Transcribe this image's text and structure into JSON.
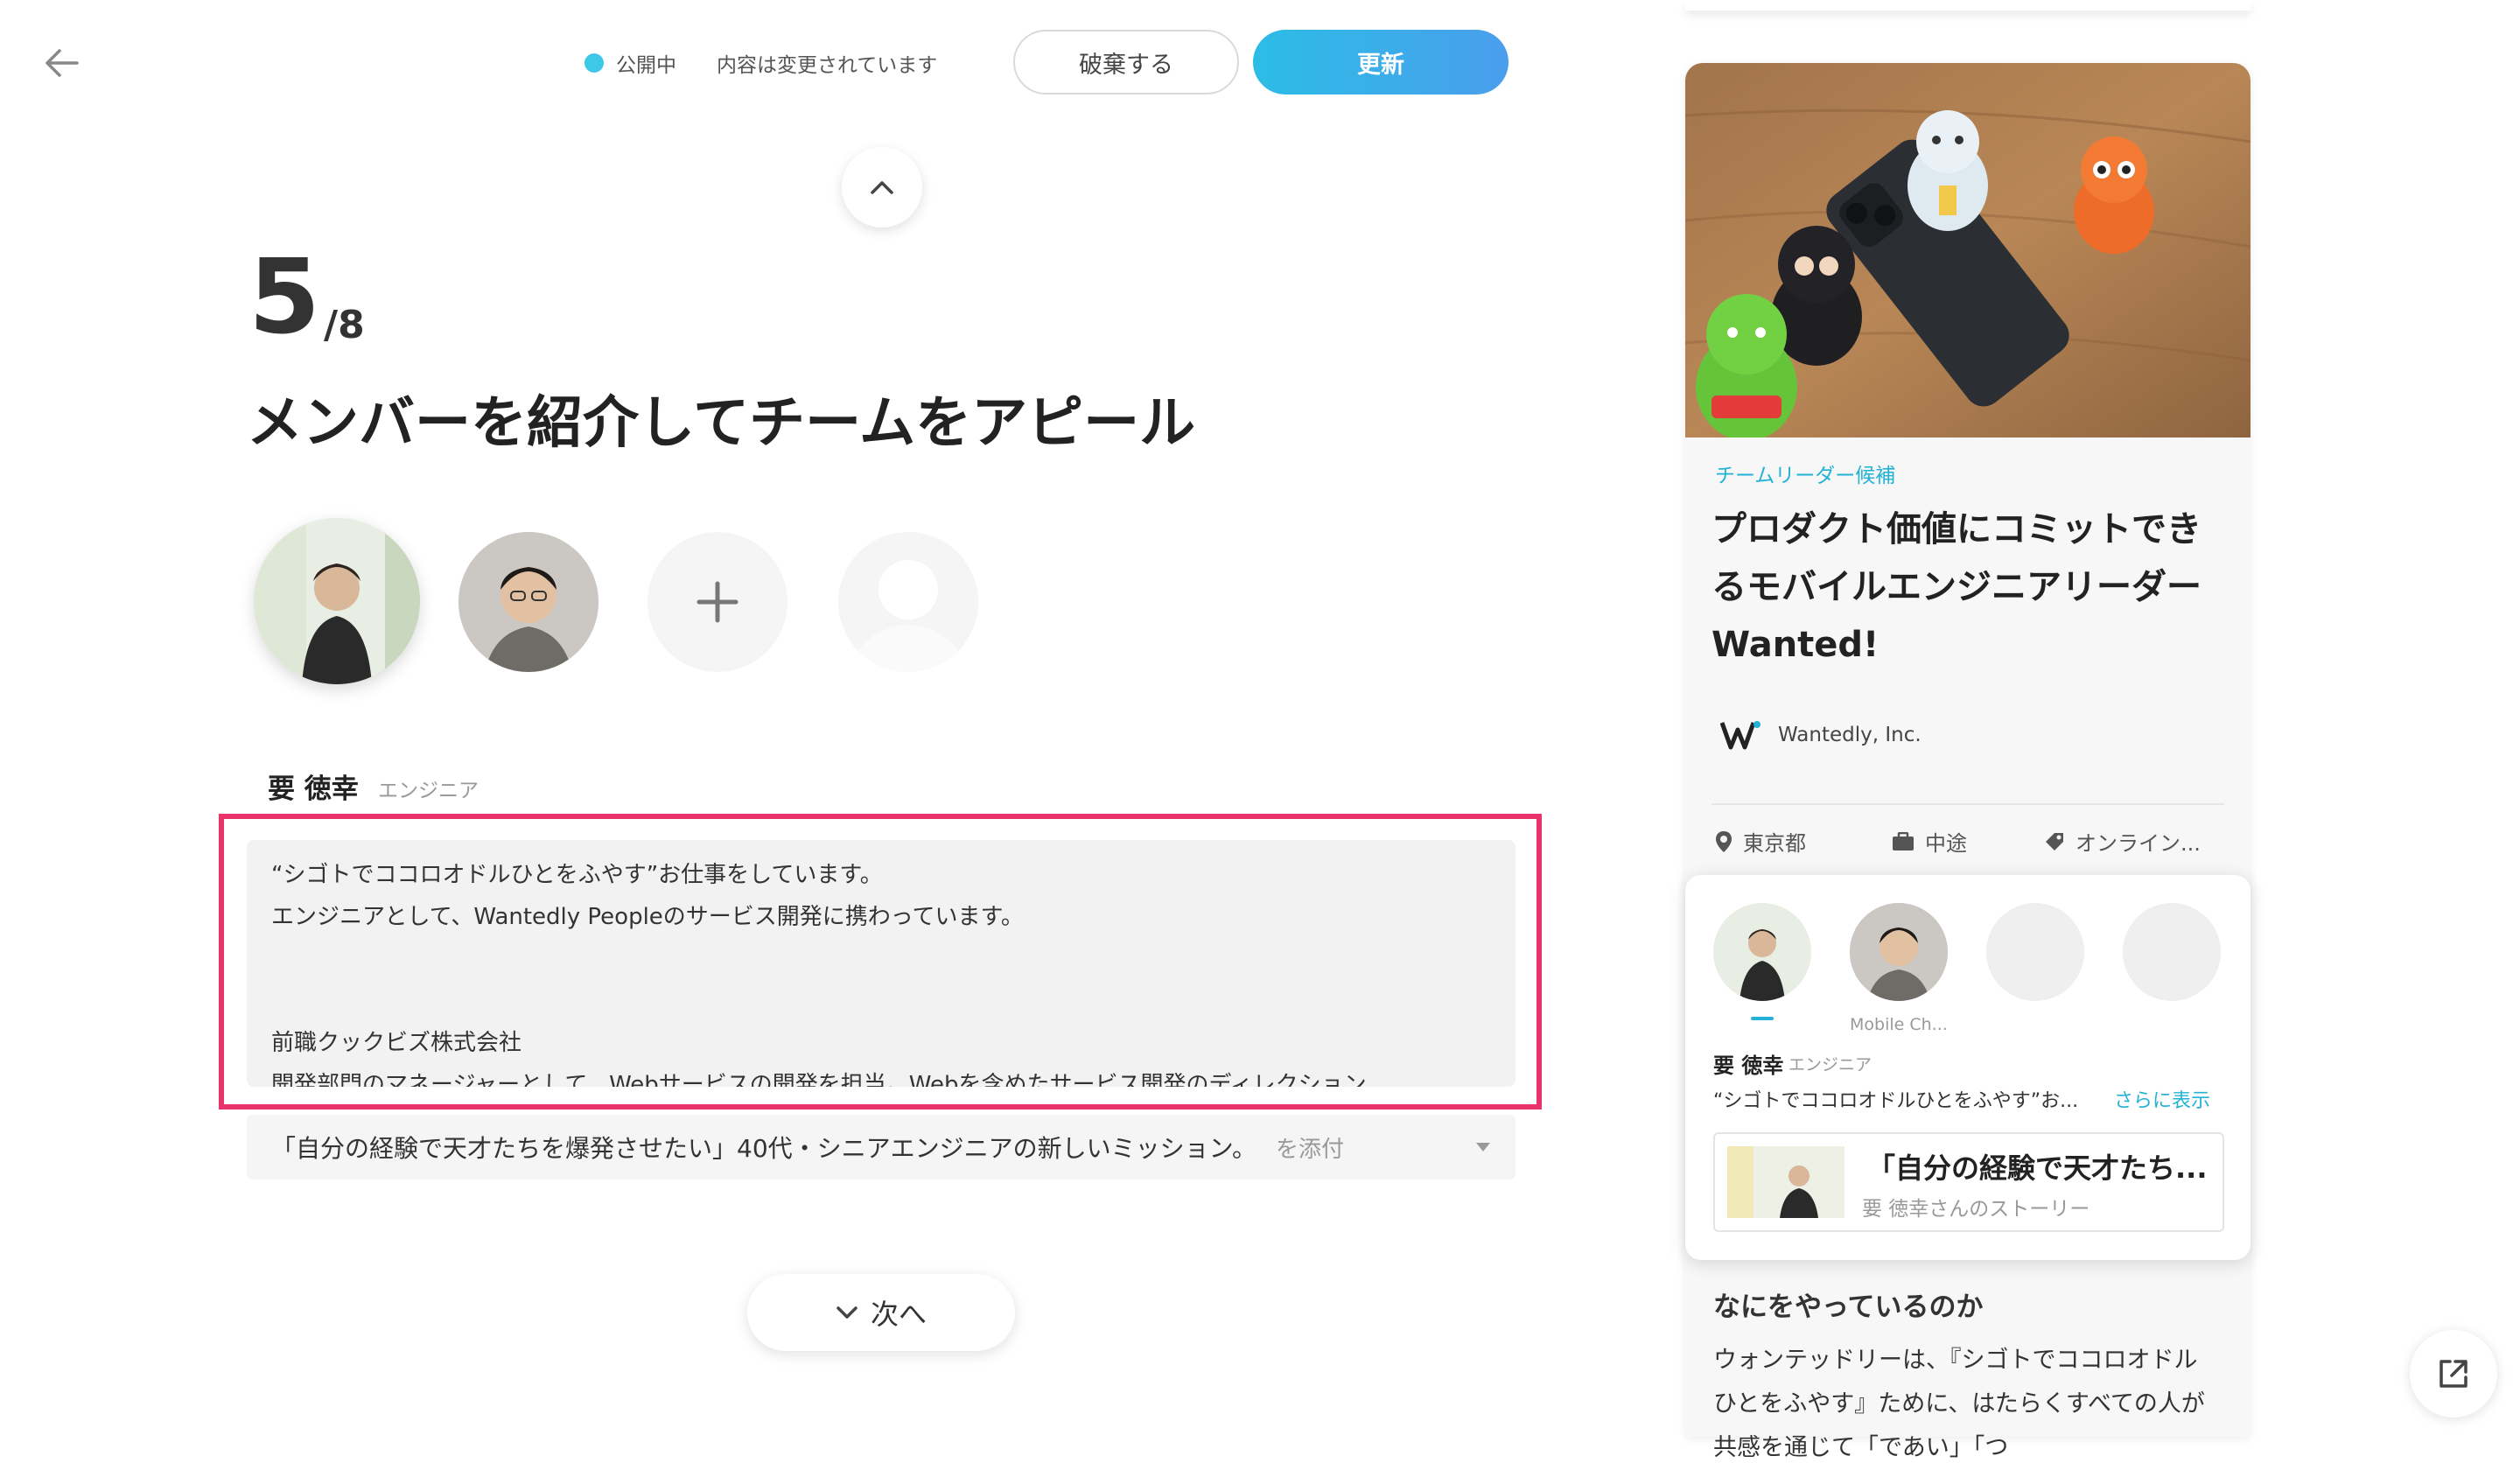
{
  "header": {
    "status_label": "公開中",
    "status_note": "内容は変更されています",
    "discard_label": "破棄する",
    "update_label": "更新",
    "status_color": "#3ec8e8"
  },
  "step": {
    "current": "5",
    "total": "/8",
    "title": "メンバーを紹介してチームをアピール"
  },
  "member": {
    "name": "要 徳幸",
    "role": "エンジニア",
    "bio_lines": [
      "“シゴトでココロオドルひとをふやす”お仕事をしています。",
      "エンジニアとして、Wantedly Peopleのサービス開発に携わっています。",
      "",
      "",
      "前職クックビズ株式会社",
      "開発部門のマネージャーとして、Webサービスの開発を担当。Webを含めたサービス開発のディレクション"
    ]
  },
  "story": {
    "title": "「自分の経験で天才たちを爆発させたい」40代・シニアエンジニアの新しいミッション。",
    "attach": "を添付"
  },
  "next_label": "次へ",
  "preview": {
    "tag": "チームリーダー候補",
    "title": "プロダクト価値にコミットできるモバイルエンジニアリーダーWanted!",
    "company": "Wantedly, Inc.",
    "location": "東京都",
    "hire_type": "中途",
    "tag_meta": "オンライン...",
    "member_card": {
      "second_member_role": "Mobile Ch...",
      "name": "要 徳幸",
      "role": "エンジニア",
      "bio": "“シゴトでココロオドルひとをふやす”お...",
      "more": "さらに表示",
      "story_title": "「自分の経験で天才たち...",
      "story_sub": "要 徳幸さんのストーリー"
    },
    "what_title": "なにをやっているのか",
    "what_body": "ウォンテッドリーは、『シゴトでココロオドルひとをふやす』ために、はたらくすべての人が共感を通じて「であい」「つ"
  },
  "colors": {
    "accent": "#23b2d6",
    "highlight": "#e8336b",
    "update_gradient_start": "#2bbde6",
    "update_gradient_end": "#4a9eec"
  }
}
